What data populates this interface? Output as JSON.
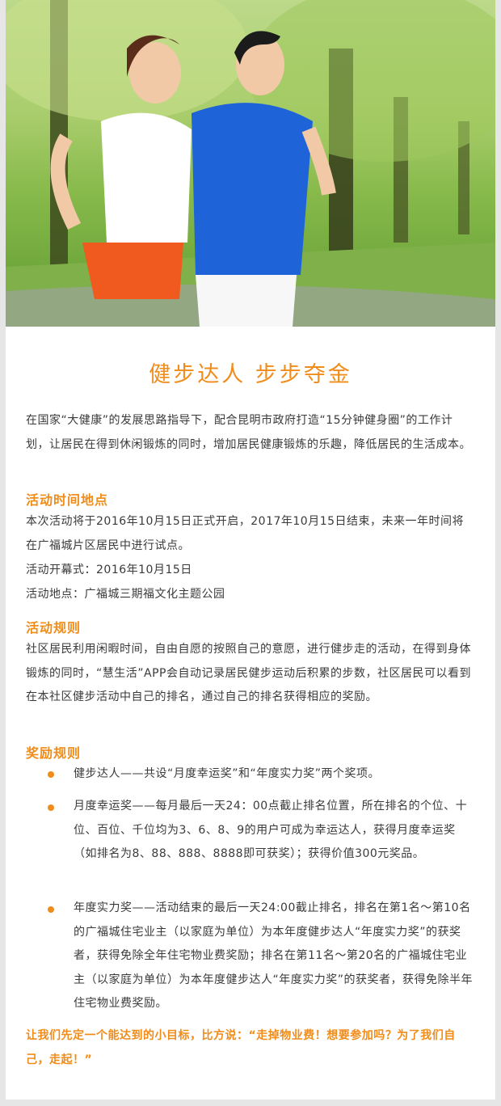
{
  "hero": {
    "alt": "Couple jogging in a park",
    "icon": "hero-photo"
  },
  "content": {
    "title": "健步达人 步步夺金",
    "intro": "在国家“大健康”的发展思路指导下，配合昆明市政府打造“15分钟健身圈”的工作计划，让居民在得到休闲锻炼的同时，增加居民健康锻炼的乐趣，降低居民的生活成本。",
    "section1": {
      "heading": "活动时间地点",
      "p1": "本次活动将于2016年10月15日正式开启，2017年10月15日结束，未来一年时间将在广福城片区居民中进行试点。",
      "p2": "活动开幕式：2016年10月15日",
      "p3": "活动地点：广福城三期福文化主题公园"
    },
    "section2": {
      "heading": "活动规则",
      "p1": "社区居民利用闲暇时间，自由自愿的按照自己的意愿，进行健步走的活动，在得到身体锻炼的同时，“慧生活”APP会自动记录居民健步运动后积累的步数，社区居民可以看到在本社区健步活动中自己的排名，通过自己的排名获得相应的奖励。"
    },
    "section3": {
      "heading": "奖励规则",
      "items": [
        "健步达人——共设“月度幸运奖”和“年度实力奖”两个奖项。",
        "月度幸运奖——每月最后一天24：00点截止排名位置，所在排名的个位、十位、百位、千位均为3、6、8、9的用户可成为幸运达人，获得月度幸运奖（如排名为8、88、888、8888即可获奖）；获得价值300元奖品。",
        "年度实力奖——活动结束的最后一天24:00截止排名，排名在第1名～第10名的广福城住宅业主（以家庭为单位）为本年度健步达人“年度实力奖”的获奖者，获得免除全年住宅物业费奖励；排名在第11名～第20名的广福城住宅业主（以家庭为单位）为本年度健步达人“年度实力奖”的获奖者，获得免除半年住宅物业费奖励。"
      ]
    },
    "cta": "让我们先定一个能达到的小目标，比方说：“走掉物业费！想要参加吗？为了我们自己，走起！”"
  },
  "colors": {
    "accent": "#f08c1a",
    "text": "#3a3a3a",
    "page_bg": "#e6e6e6"
  }
}
